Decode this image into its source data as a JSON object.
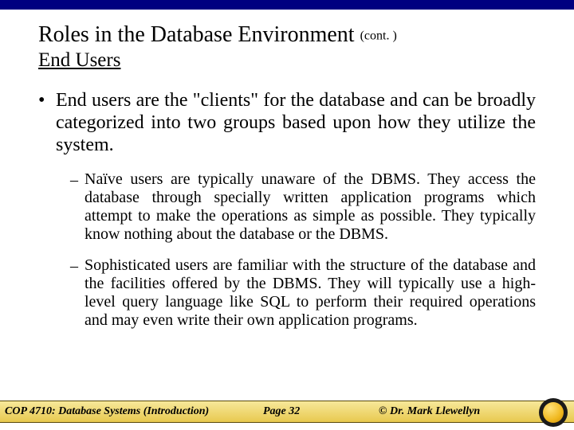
{
  "title": {
    "main": "Roles in the Database Environment",
    "cont": "(cont. )"
  },
  "subtitle": "End Users",
  "bullet1": "End users are the \"clients\" for the database and can be broadly categorized into two groups based upon how they utilize the system.",
  "sub1": "Naïve users are typically unaware of the DBMS.  They access the database through specially written application programs which attempt to make the operations as simple as possible.  They typically know nothing about the database or the DBMS.",
  "sub2": "Sophisticated users are familiar with the structure of the database and the facilities offered by the DBMS.  They will typically use a high-level query language like SQL to perform their required operations and may even write their own application programs.",
  "footer": {
    "left": "COP 4710: Database Systems  (Introduction)",
    "center": "Page 32",
    "right": "©  Dr. Mark Llewellyn"
  }
}
